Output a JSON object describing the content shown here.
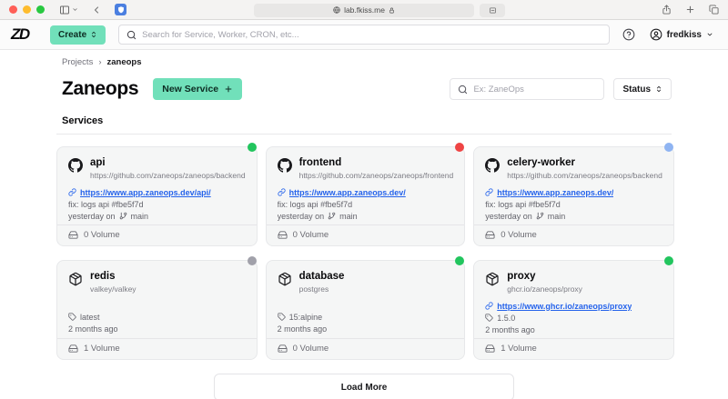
{
  "browser": {
    "url": "lab.fkiss.me"
  },
  "header": {
    "logo": "ZD",
    "create_label": "Create",
    "search_placeholder": "Search for Service, Worker, CRON, etc...",
    "username": "fredkiss"
  },
  "breadcrumb": {
    "items": [
      "Projects",
      "zaneops"
    ],
    "separator": "›"
  },
  "page": {
    "title": "Zaneops",
    "new_service_label": "New Service",
    "filter_placeholder": "Ex: ZaneOps",
    "status_label": "Status",
    "section_title": "Services",
    "load_more_label": "Load More"
  },
  "colors": {
    "accent_mint": "#71e0ba",
    "status_healthy": "#22c55e",
    "status_unhealthy": "#ef4444",
    "status_deploying": "#8fb4f2",
    "status_sleeping": "#a1a1aa",
    "link_blue": "#2563eb"
  },
  "services": [
    {
      "name": "api",
      "type": "git",
      "source": "https://github.com/zaneops/zaneops/backend",
      "url": "https://www.app.zaneops.dev/api/",
      "commit": "fix: logs api #fbe5f7d",
      "deployed_prefix": "yesterday on",
      "branch": "main",
      "volumes": "0 Volume",
      "status_color": "#22c55e"
    },
    {
      "name": "frontend",
      "type": "git",
      "source": "https://github.com/zaneops/zaneops/frontend",
      "url": "https://www.app.zaneops.dev/",
      "commit": "fix: logs api #fbe5f7d",
      "deployed_prefix": "yesterday on",
      "branch": "main",
      "volumes": "0 Volume",
      "status_color": "#ef4444"
    },
    {
      "name": "celery-worker",
      "type": "git",
      "source": "https://github.com/zaneops/zaneops/backend",
      "url": "https://www.app.zaneops.dev/",
      "commit": "fix: logs api #fbe5f7d",
      "deployed_prefix": "yesterday on",
      "branch": "main",
      "volumes": "0 Volume",
      "status_color": "#8fb4f2"
    },
    {
      "name": "redis",
      "type": "docker",
      "source": "valkey/valkey",
      "tag": "latest",
      "updated": "2 months ago",
      "volumes": "1 Volume",
      "status_color": "#a1a1aa"
    },
    {
      "name": "database",
      "type": "docker",
      "source": "postgres",
      "tag": "15:alpine",
      "updated": "2 months ago",
      "volumes": "0 Volume",
      "status_color": "#22c55e"
    },
    {
      "name": "proxy",
      "type": "docker",
      "source": "ghcr.io/zaneops/proxy",
      "url": "https://www.ghcr.io/zaneops/proxy",
      "tag": "1.5.0",
      "updated": "2 months ago",
      "volumes": "1 Volume",
      "status_color": "#22c55e"
    }
  ]
}
